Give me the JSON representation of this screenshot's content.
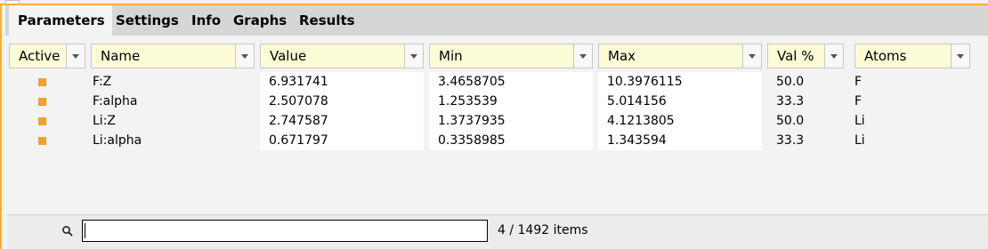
{
  "tabs": [
    "Parameters",
    "Settings",
    "Info",
    "Graphs",
    "Results"
  ],
  "active_tab": "Parameters",
  "columns": [
    "Active",
    "Name",
    "Value",
    "Min",
    "Max",
    "Val %",
    "Atoms"
  ],
  "rows": [
    {
      "name": "F:Z",
      "value": "6.931741",
      "min": "3.4658705",
      "max": "10.3976115",
      "valpct": "50.0",
      "atoms": "F"
    },
    {
      "name": "F:alpha",
      "value": "2.507078",
      "min": "1.253539",
      "max": "5.014156",
      "valpct": "33.3",
      "atoms": "F"
    },
    {
      "name": "Li:Z",
      "value": "2.747587",
      "min": "1.3737935",
      "max": "4.1213805",
      "valpct": "50.0",
      "atoms": "Li"
    },
    {
      "name": "Li:alpha",
      "value": "0.671797",
      "min": "0.3358985",
      "max": "1.343594",
      "valpct": "33.3",
      "atoms": "Li"
    }
  ],
  "search": {
    "value": "",
    "icon": "search-icon"
  },
  "count_text": "4 / 1492 items",
  "colors": {
    "accent": "#f2b237",
    "marker": "#f2a12a",
    "header_bg": "#fbfbd6"
  }
}
